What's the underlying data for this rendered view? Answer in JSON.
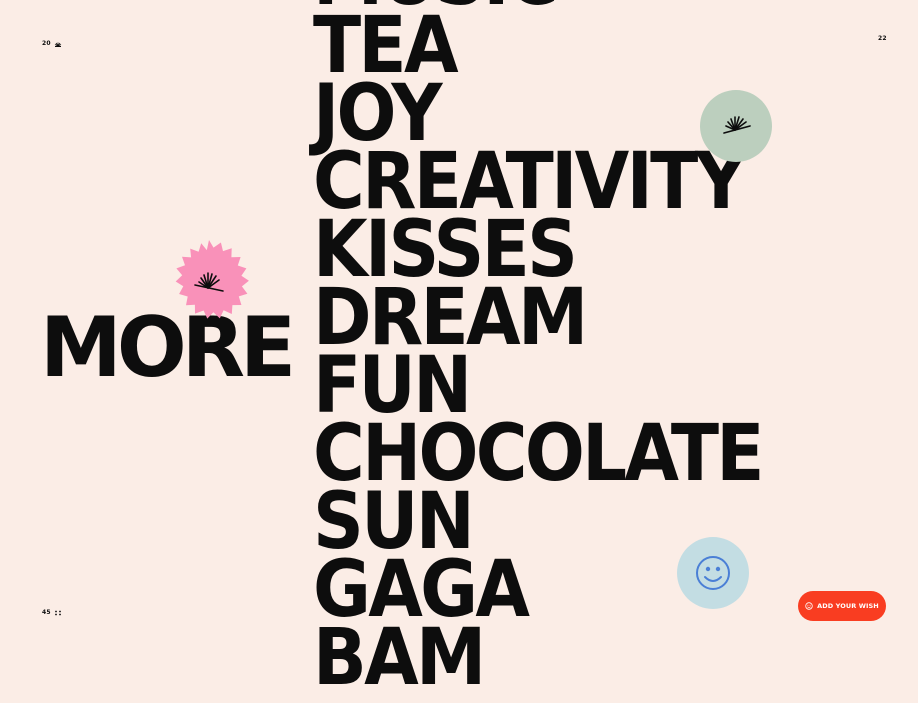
{
  "corners": {
    "top_left": "20",
    "top_right": "22",
    "bottom_left": "45"
  },
  "headline": "MORE",
  "words": [
    "MUSIC",
    "TEA",
    "JOY",
    "CREATIVITY",
    "KISSES",
    "DREAM",
    "FUN",
    "CHOCOLATE",
    "SUN",
    "GAGA",
    "BAM"
  ],
  "icons": {
    "green_badge": "sunburst-icon",
    "pink_badge": "sunburst-icon",
    "blue_badge": "smiley-face-icon",
    "cta": "smiley-icon"
  },
  "cta": {
    "label": "ADD YOUR WISH"
  },
  "colors": {
    "background": "#fbede6",
    "text": "#0d0d0d",
    "green_badge": "#bccfbe",
    "pink_badge": "#f991b9",
    "blue_badge": "#c3dde3",
    "blue_icon": "#4a7fd6",
    "cta": "#f93d21"
  }
}
